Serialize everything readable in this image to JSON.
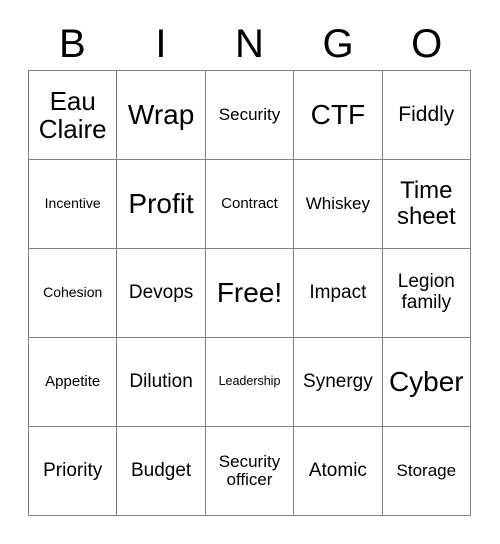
{
  "card": {
    "title": "BINGO",
    "header_letters": [
      "B",
      "I",
      "N",
      "G",
      "O"
    ],
    "grid_size": "5x5",
    "colors": {
      "background": "#ffffff",
      "text": "#000000",
      "grid_line": "#808080"
    }
  },
  "grid": {
    "rows": [
      [
        {
          "text": "Eau\nClaire",
          "size": "xl"
        },
        {
          "text": "Wrap",
          "size": "xxl"
        },
        {
          "text": "Security",
          "size": "sm"
        },
        {
          "text": "CTF",
          "size": "xxl"
        },
        {
          "text": "Fiddly",
          "size": "ml"
        }
      ],
      [
        {
          "text": "Incentive",
          "size": "xs"
        },
        {
          "text": "Profit",
          "size": "xxl"
        },
        {
          "text": "Contract",
          "size": "s"
        },
        {
          "text": "Whiskey",
          "size": "sm"
        },
        {
          "text": "Time\nsheet",
          "size": "l"
        }
      ],
      [
        {
          "text": "Cohesion",
          "size": "xs"
        },
        {
          "text": "Devops",
          "size": "m"
        },
        {
          "text": "Free!",
          "size": "xxl"
        },
        {
          "text": "Impact",
          "size": "m"
        },
        {
          "text": "Legion\nfamily",
          "size": "m"
        }
      ],
      [
        {
          "text": "Appetite",
          "size": "s"
        },
        {
          "text": "Dilution",
          "size": "m"
        },
        {
          "text": "Leadership",
          "size": "xxs"
        },
        {
          "text": "Synergy",
          "size": "m"
        },
        {
          "text": "Cyber",
          "size": "xxl"
        }
      ],
      [
        {
          "text": "Priority",
          "size": "m"
        },
        {
          "text": "Budget",
          "size": "m"
        },
        {
          "text": "Security\nofficer",
          "size": "sm"
        },
        {
          "text": "Atomic",
          "size": "m"
        },
        {
          "text": "Storage",
          "size": "sm"
        }
      ]
    ],
    "free_space": {
      "row": 2,
      "col": 2,
      "label": "Free!"
    }
  }
}
